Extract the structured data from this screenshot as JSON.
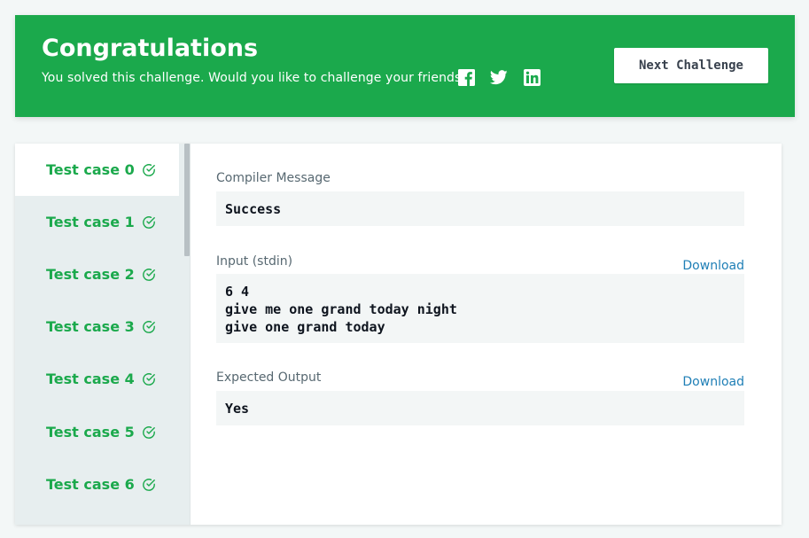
{
  "banner": {
    "title": "Congratulations",
    "subtitle": "You solved this challenge. Would you like to challenge your friends?",
    "social_icons": [
      "facebook-icon",
      "twitter-icon",
      "linkedin-icon"
    ],
    "next_label": "Next Challenge"
  },
  "tabs": [
    {
      "label": "Test case 0",
      "passed": true,
      "active": true
    },
    {
      "label": "Test case 1",
      "passed": true,
      "active": false
    },
    {
      "label": "Test case 2",
      "passed": true,
      "active": false
    },
    {
      "label": "Test case 3",
      "passed": true,
      "active": false
    },
    {
      "label": "Test case 4",
      "passed": true,
      "active": false
    },
    {
      "label": "Test case 5",
      "passed": true,
      "active": false
    },
    {
      "label": "Test case 6",
      "passed": true,
      "active": false
    }
  ],
  "result": {
    "compiler_label": "Compiler Message",
    "compiler_value": "Success",
    "input_label": "Input (stdin)",
    "input_download": "Download",
    "input_lines": [
      "6 4",
      "give me one grand today night",
      "give one grand today"
    ],
    "expected_label": "Expected Output",
    "expected_download": "Download",
    "expected_value": "Yes"
  },
  "colors": {
    "accent": "#1ba94c",
    "link": "#1f7fb6",
    "text": "#0e141e"
  }
}
